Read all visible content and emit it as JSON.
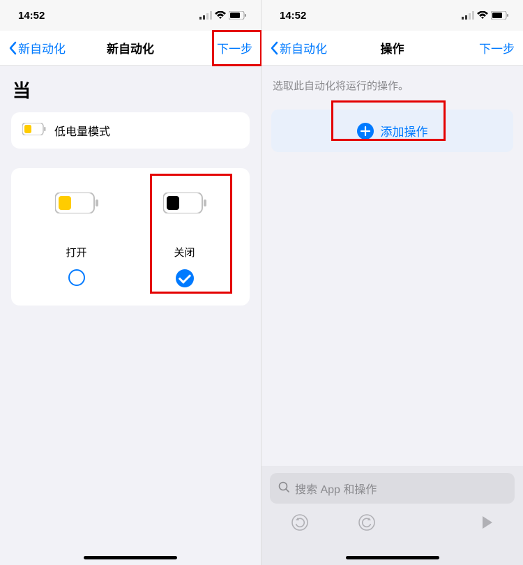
{
  "status": {
    "time": "14:52"
  },
  "left": {
    "nav": {
      "back": "新自动化",
      "title": "新自动化",
      "next": "下一步"
    },
    "header": "当",
    "condition": {
      "label": "低电量模式"
    },
    "options": {
      "open": {
        "label": "打开"
      },
      "close": {
        "label": "关闭"
      }
    }
  },
  "right": {
    "nav": {
      "back": "新自动化",
      "title": "操作",
      "next": "下一步"
    },
    "description": "选取此自动化将运行的操作。",
    "addAction": "添加操作",
    "search": {
      "placeholder": "搜索 App 和操作"
    }
  }
}
